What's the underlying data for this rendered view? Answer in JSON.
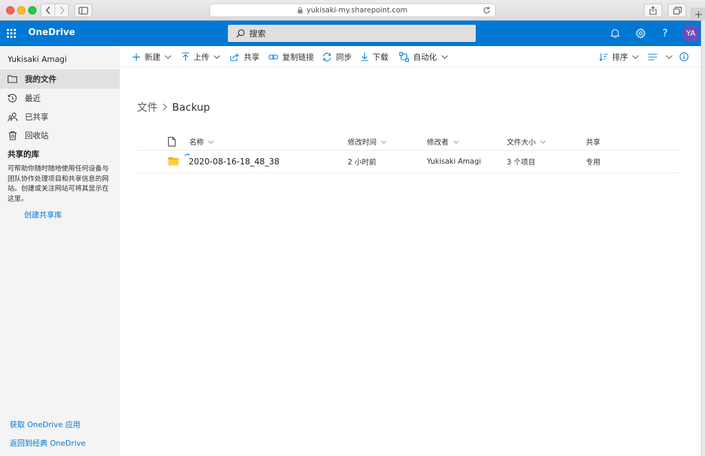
{
  "browser": {
    "url": "yukisaki-my.sharepoint.com",
    "new_tab": "+"
  },
  "suite": {
    "app_name": "OneDrive",
    "search_placeholder": "搜索",
    "help": "?",
    "avatar_initials": "YA"
  },
  "leftnav": {
    "user_name": "Yukisaki Amagi",
    "items": [
      {
        "label": "我的文件",
        "icon": "folder-icon",
        "active": true
      },
      {
        "label": "最近",
        "icon": "history-icon"
      },
      {
        "label": "已共享",
        "icon": "shared-people-icon"
      },
      {
        "label": "回收站",
        "icon": "recycle-bin-icon"
      }
    ],
    "libraries_heading": "共享的库",
    "libraries_description": "可帮助你随时随地使用任何设备与团队协作处理项目和共享信息的网站。创建或关注网站可将其显示在这里。",
    "create_library": "创建共享库",
    "get_app": "获取 OneDrive 应用",
    "classic": "返回到经典 OneDrive"
  },
  "commands": {
    "new": "新建",
    "upload": "上传",
    "share": "共享",
    "copy_link": "复制链接",
    "sync": "同步",
    "download": "下载",
    "automate": "自动化",
    "sort": "排序"
  },
  "breadcrumb": {
    "root": "文件",
    "current": "Backup"
  },
  "list": {
    "columns": {
      "name": "名称",
      "modified": "修改时间",
      "modified_by": "修改者",
      "file_size": "文件大小",
      "sharing": "共享"
    },
    "rows": [
      {
        "name": "2020-08-16-18_48_38",
        "modified": "2 小时前",
        "modified_by": "Yukisaki Amagi",
        "file_size": "3 个项目",
        "sharing": "专用"
      }
    ]
  },
  "colors": {
    "brand_blue": "#0078d4",
    "avatar_purple": "#6b4fb9",
    "folder_yellow": "#ffce3d"
  }
}
